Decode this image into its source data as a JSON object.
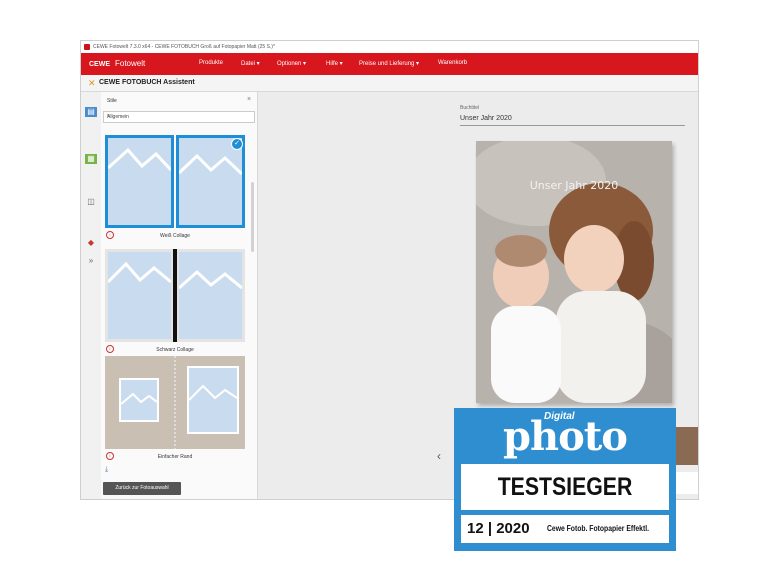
{
  "window": {
    "title": "CEWE Fotowelt 7.3.0 x64  - CEWE FOTOBUCH Groß auf Fotopapier Matt (25 S.)*"
  },
  "menubar": {
    "brand": "CEWE",
    "app_name": "Fotowelt",
    "items": [
      "Produkte",
      "Datei",
      "Optionen",
      "Hilfe",
      "Preise und Lieferung",
      "Warenkorb"
    ]
  },
  "subbar": {
    "title": "CEWE FOTOBUCH Assistent"
  },
  "side_panel": {
    "title": "Stile",
    "select_value": "Allgemein",
    "styles": [
      {
        "label": "Weiß Collage",
        "selected": true
      },
      {
        "label": "Schwarz Collage",
        "selected": false
      },
      {
        "label": "Einfacher Rand",
        "selected": false
      }
    ],
    "back_button": "Zurück zur Fotoauswahl"
  },
  "workspace": {
    "book_title_label": "Buchtitel",
    "book_title_value": "Unser Jahr 2020",
    "cover_title": "Unser Jahr 2020"
  },
  "badge": {
    "digital": "Digital",
    "photo": "photo",
    "award": "TESTSIEGER",
    "issue": "12 | 2020",
    "product": "Cewe Fotob. Fotopapier Effektl."
  },
  "colors": {
    "brand_red": "#d7161e",
    "selection_blue": "#1e8fd6",
    "badge_blue": "#2f8ecf"
  }
}
